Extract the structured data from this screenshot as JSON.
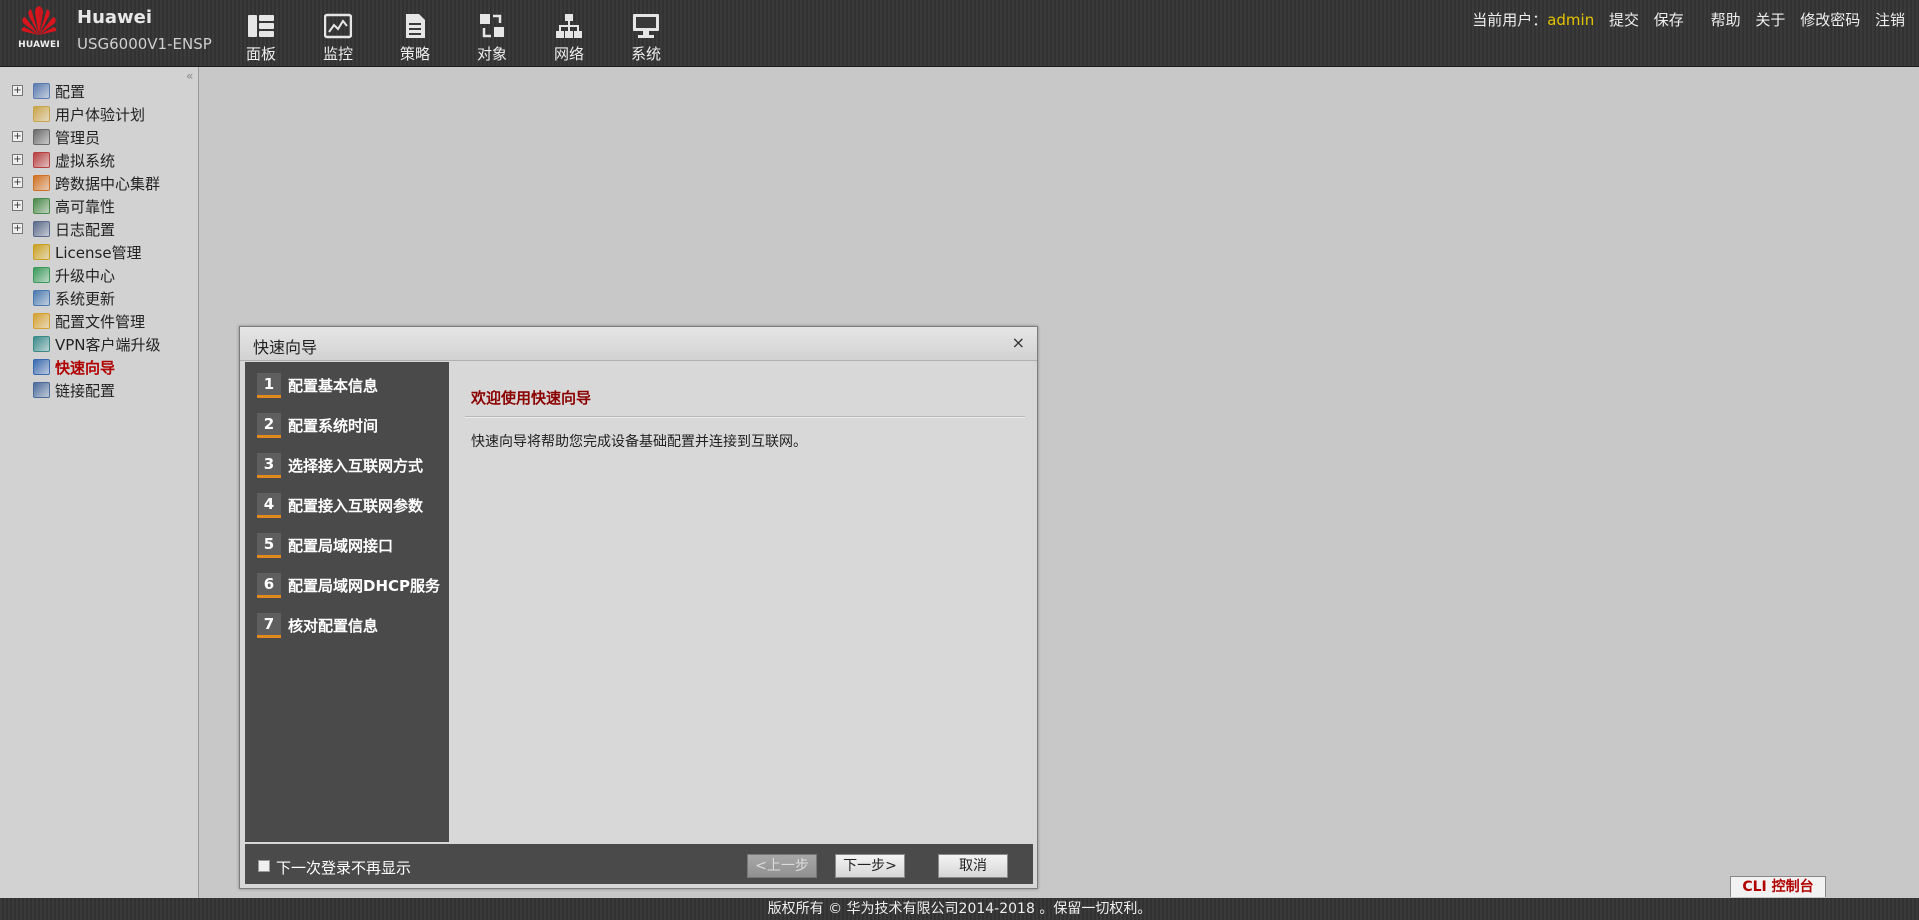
{
  "header": {
    "logo_text": "HUAWEI",
    "brand": "Huawei",
    "model": "USG6000V1-ENSP",
    "nav": [
      {
        "label": "面板",
        "icon": "dashboard-icon"
      },
      {
        "label": "监控",
        "icon": "monitor-icon"
      },
      {
        "label": "策略",
        "icon": "policy-icon"
      },
      {
        "label": "对象",
        "icon": "object-icon"
      },
      {
        "label": "网络",
        "icon": "network-icon"
      },
      {
        "label": "系统",
        "icon": "system-icon"
      }
    ],
    "user_label": "当前用户：",
    "username": "admin",
    "links": [
      "提交",
      "保存",
      "帮助",
      "关于",
      "修改密码",
      "注销"
    ]
  },
  "sidebar": {
    "collapse": "«",
    "items": [
      {
        "label": "配置",
        "expandable": true,
        "icon": "config-icon",
        "color": "#5a7ab0"
      },
      {
        "label": "用户体验计划",
        "expandable": false,
        "icon": "user-experience-icon",
        "color": "#c9a44a"
      },
      {
        "label": "管理员",
        "expandable": true,
        "icon": "admin-icon",
        "color": "#6a6a6a"
      },
      {
        "label": "虚拟系统",
        "expandable": true,
        "icon": "virtual-system-icon",
        "color": "#b84040"
      },
      {
        "label": "跨数据中心集群",
        "expandable": true,
        "icon": "cluster-icon",
        "color": "#d07020"
      },
      {
        "label": "高可靠性",
        "expandable": true,
        "icon": "reliability-icon",
        "color": "#4a8a4a"
      },
      {
        "label": "日志配置",
        "expandable": true,
        "icon": "log-config-icon",
        "color": "#5a6a8a"
      },
      {
        "label": "License管理",
        "expandable": false,
        "icon": "license-icon",
        "color": "#c9a020"
      },
      {
        "label": "升级中心",
        "expandable": false,
        "icon": "upgrade-icon",
        "color": "#3a9a5a"
      },
      {
        "label": "系统更新",
        "expandable": false,
        "icon": "system-update-icon",
        "color": "#4a7ab0"
      },
      {
        "label": "配置文件管理",
        "expandable": false,
        "icon": "config-file-icon",
        "color": "#d4a030"
      },
      {
        "label": "VPN客户端升级",
        "expandable": false,
        "icon": "vpn-client-icon",
        "color": "#3a8a8a"
      },
      {
        "label": "快速向导",
        "expandable": false,
        "icon": "quick-wizard-icon",
        "color": "#3a6ab0",
        "active": true
      },
      {
        "label": "链接配置",
        "expandable": false,
        "icon": "link-config-icon",
        "color": "#4a6a9a"
      }
    ]
  },
  "dialog": {
    "title": "快速向导",
    "close": "×",
    "steps": [
      {
        "num": "1",
        "label": "配置基本信息"
      },
      {
        "num": "2",
        "label": "配置系统时间"
      },
      {
        "num": "3",
        "label": "选择接入互联网方式"
      },
      {
        "num": "4",
        "label": "配置接入互联网参数"
      },
      {
        "num": "5",
        "label": "配置局域网接口"
      },
      {
        "num": "6",
        "label": "配置局域网DHCP服务"
      },
      {
        "num": "7",
        "label": "核对配置信息"
      }
    ],
    "welcome": "欢迎使用快速向导",
    "description": "快速向导将帮助您完成设备基础配置并连接到互联网。",
    "no_show_label": "下一次登录不再显示",
    "no_show_checked": false,
    "prev_button": "<上一步",
    "next_button": "下一步>",
    "cancel_button": "取消"
  },
  "cli_button": "CLI 控制台",
  "footer": "版权所有 © 华为技术有限公司2014-2018 。保留一切权利。",
  "colors": {
    "accent": "#e08a1e",
    "active": "#b00000",
    "username": "#e4c400"
  }
}
